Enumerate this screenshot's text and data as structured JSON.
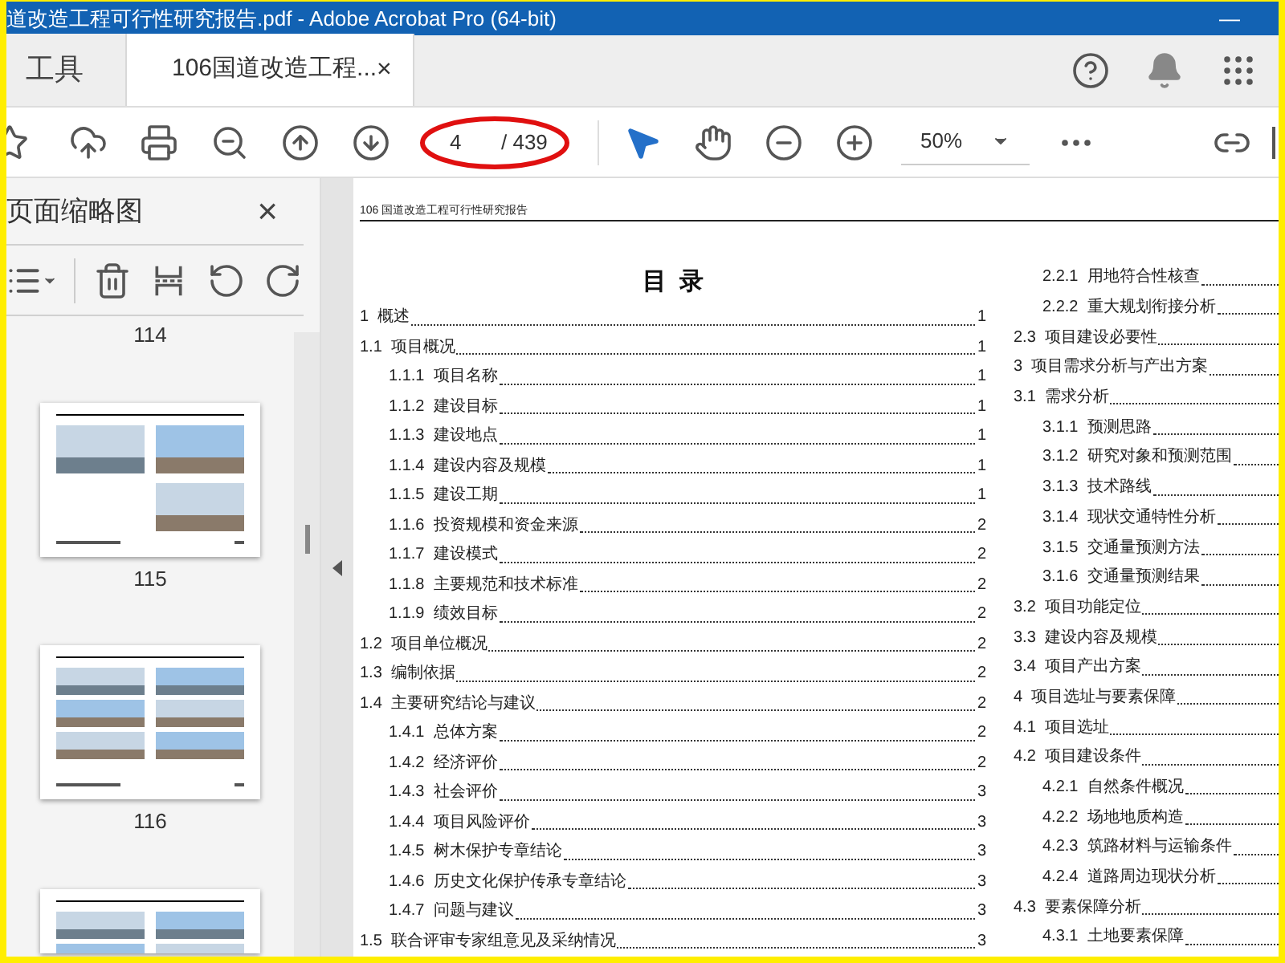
{
  "window": {
    "title": "道改造工程可行性研究报告.pdf - Adobe Acrobat Pro (64-bit)",
    "minimize": "—"
  },
  "tabs": [
    {
      "label": "工具",
      "selected": false
    },
    {
      "label": "106国道改造工程...",
      "selected": true,
      "close": "×"
    }
  ],
  "toolbar": {
    "page": "4",
    "total": "/ 439",
    "zoom": "50%"
  },
  "sidebar": {
    "title": "页面缩略图",
    "close": "×",
    "page_labels": [
      "114",
      "115",
      "116"
    ]
  },
  "document": {
    "header": "106 国道改造工程可行性研究报告",
    "title": "目  录",
    "left_column": [
      {
        "number": "1",
        "text": "概述",
        "page": "1"
      },
      {
        "number": "1.1",
        "text": "项目概况",
        "page": "1",
        "children": [
          {
            "number": "1.1.1",
            "text": "项目名称",
            "page": "1"
          },
          {
            "number": "1.1.2",
            "text": "建设目标",
            "page": "1"
          },
          {
            "number": "1.1.3",
            "text": "建设地点",
            "page": "1"
          },
          {
            "number": "1.1.4",
            "text": "建设内容及规模",
            "page": "1"
          },
          {
            "number": "1.1.5",
            "text": "建设工期",
            "page": "1"
          },
          {
            "number": "1.1.6",
            "text": "投资规模和资金来源",
            "page": "2"
          },
          {
            "number": "1.1.7",
            "text": "建设模式",
            "page": "2"
          },
          {
            "number": "1.1.8",
            "text": "主要规范和技术标准",
            "page": "2"
          },
          {
            "number": "1.1.9",
            "text": "绩效目标",
            "page": "2"
          }
        ]
      },
      {
        "number": "1.2",
        "text": "项目单位概况",
        "page": "2"
      },
      {
        "number": "1.3",
        "text": "编制依据",
        "page": "2"
      },
      {
        "number": "1.4",
        "text": "主要研究结论与建议",
        "page": "2",
        "children": [
          {
            "number": "1.4.1",
            "text": "总体方案",
            "page": "2"
          },
          {
            "number": "1.4.2",
            "text": "经济评价",
            "page": "2"
          },
          {
            "number": "1.4.3",
            "text": "社会评价",
            "page": "3"
          },
          {
            "number": "1.4.4",
            "text": "项目风险评价",
            "page": "3"
          },
          {
            "number": "1.4.5",
            "text": "树木保护专章结论",
            "page": "3"
          },
          {
            "number": "1.4.6",
            "text": "历史文化保护传承专章结论",
            "page": "3"
          },
          {
            "number": "1.4.7",
            "text": "问题与建议",
            "page": "3"
          }
        ]
      },
      {
        "number": "1.5",
        "text": "联合评审专家组意见及采纳情况",
        "page": "3"
      }
    ],
    "right_column": [
      {
        "children": [
          {
            "number": "2.2.1",
            "text": "用地符合性核查"
          },
          {
            "number": "2.2.2",
            "text": "重大规划衔接分析"
          }
        ]
      },
      {
        "number": "2.3",
        "text": "项目建设必要性"
      },
      {
        "number": "3",
        "text": "项目需求分析与产出方案"
      },
      {
        "number": "3.1",
        "text": "需求分析",
        "children": [
          {
            "number": "3.1.1",
            "text": "预测思路"
          },
          {
            "number": "3.1.2",
            "text": "研究对象和预测范围"
          },
          {
            "number": "3.1.3",
            "text": "技术路线"
          },
          {
            "number": "3.1.4",
            "text": "现状交通特性分析"
          },
          {
            "number": "3.1.5",
            "text": "交通量预测方法"
          },
          {
            "number": "3.1.6",
            "text": "交通量预测结果"
          }
        ]
      },
      {
        "number": "3.2",
        "text": "项目功能定位"
      },
      {
        "number": "3.3",
        "text": "建设内容及规模"
      },
      {
        "number": "3.4",
        "text": "项目产出方案"
      },
      {
        "number": "4",
        "text": "项目选址与要素保障"
      },
      {
        "number": "4.1",
        "text": "项目选址"
      },
      {
        "number": "4.2",
        "text": "项目建设条件",
        "children": [
          {
            "number": "4.2.1",
            "text": "自然条件概况"
          },
          {
            "number": "4.2.2",
            "text": "场地地质构造"
          },
          {
            "number": "4.2.3",
            "text": "筑路材料与运输条件"
          },
          {
            "number": "4.2.4",
            "text": "道路周边现状分析"
          }
        ]
      },
      {
        "number": "4.3",
        "text": "要素保障分析",
        "children": [
          {
            "number": "4.3.1",
            "text": "土地要素保障"
          }
        ]
      }
    ]
  }
}
